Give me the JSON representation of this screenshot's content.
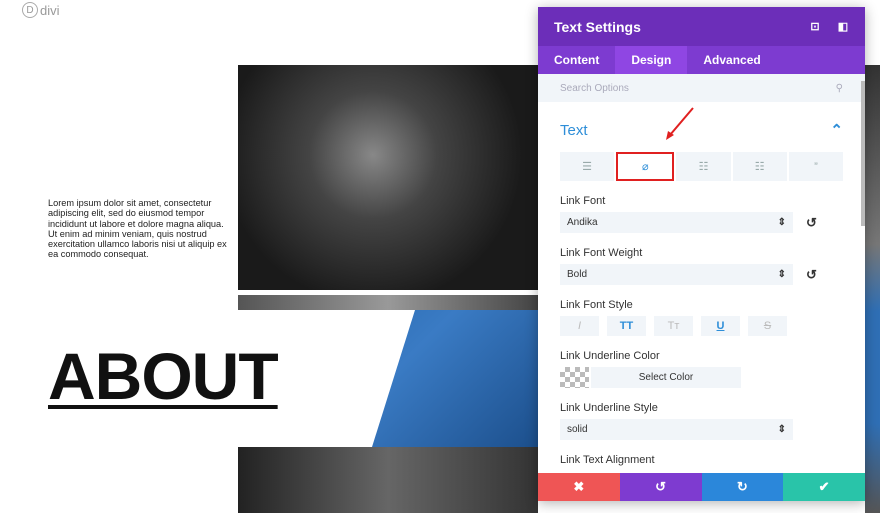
{
  "logo": {
    "mark": "D",
    "text": "divi"
  },
  "page": {
    "lorem": "Lorem ipsum dolor sit amet, consectetur adipiscing elit, sed do eiusmod tempor incididunt ut labore et dolore magna aliqua. Ut enim ad minim veniam, quis nostrud exercitation ullamco laboris nisi ut aliquip ex ea commodo consequat.",
    "heading": "ABOUT"
  },
  "panel": {
    "title": "Text Settings",
    "tabs": [
      {
        "label": "Content"
      },
      {
        "label": "Design"
      },
      {
        "label": "Advanced"
      }
    ],
    "active_tab": "Design",
    "search_placeholder": "Search Options",
    "section": "Text",
    "link_font": {
      "label": "Link Font",
      "value": "Andika"
    },
    "link_font_weight": {
      "label": "Link Font Weight",
      "value": "Bold"
    },
    "link_font_style": {
      "label": "Link Font Style",
      "options": [
        "I",
        "TT",
        "Tт",
        "U",
        "S"
      ],
      "active": [
        "TT",
        "U"
      ]
    },
    "link_underline_color": {
      "label": "Link Underline Color",
      "button": "Select Color"
    },
    "link_underline_style": {
      "label": "Link Underline Style",
      "value": "solid"
    },
    "link_text_alignment": {
      "label": "Link Text Alignment"
    },
    "colors": {
      "header": "#6c2eb9",
      "tabs": "#7d3bd0",
      "accent": "#2e8ed8",
      "cancel": "#ef5555",
      "undo": "#7e3bd0",
      "redo": "#2b87da",
      "save": "#29c4a9"
    }
  }
}
